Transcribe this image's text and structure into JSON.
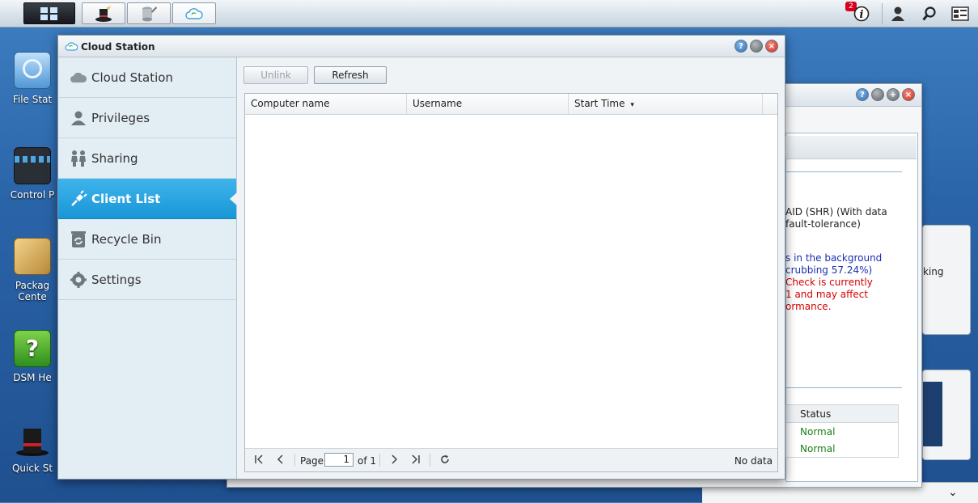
{
  "taskbar": {
    "notification_count": "2",
    "notif_color": "#d8001c"
  },
  "desktop": {
    "icons": [
      {
        "label": "File Stat",
        "icon": "file-station-icon"
      },
      {
        "label": "Control P",
        "icon": "control-panel-icon"
      },
      {
        "label": "Packag",
        "label2": "Cente",
        "icon": "package-center-icon"
      },
      {
        "label": "DSM He",
        "icon": "dsm-help-icon"
      },
      {
        "label": "Quick St",
        "icon": "quick-start-icon"
      }
    ]
  },
  "background_window": {
    "text_lines": {
      "l1": "AID (SHR) (With data",
      "l2": "fault-tolerance)",
      "l3": "s in the background",
      "l4": "crubbing 57.24%)",
      "l5": "Check is currently",
      "l6": "1 and may affect",
      "l7": "ormance."
    },
    "right_text": "king",
    "table": {
      "header": "Status",
      "rows": [
        "Normal",
        "Normal"
      ]
    },
    "colors": {
      "blue": "#1a2fb0",
      "red": "#d40000",
      "green": "#1a7f1a"
    }
  },
  "main_window": {
    "title": "Cloud Station",
    "sidebar": {
      "items": [
        {
          "label": "Cloud Station",
          "icon": "cloud-icon",
          "active": false
        },
        {
          "label": "Privileges",
          "icon": "user-icon",
          "active": false
        },
        {
          "label": "Sharing",
          "icon": "people-icon",
          "active": false
        },
        {
          "label": "Client List",
          "icon": "plug-icon",
          "active": true
        },
        {
          "label": "Recycle Bin",
          "icon": "recycle-icon",
          "active": false
        },
        {
          "label": "Settings",
          "icon": "gear-icon",
          "active": false
        }
      ]
    },
    "toolbar": {
      "unlink_label": "Unlink",
      "refresh_label": "Refresh"
    },
    "grid": {
      "columns": [
        "Computer name",
        "Username",
        "Start Time"
      ],
      "sort_indicator": "▾",
      "rows": []
    },
    "pager": {
      "page_label": "Page",
      "page_value": "1",
      "of_label": "of 1",
      "status": "No data"
    },
    "accent": "#1896d6"
  }
}
